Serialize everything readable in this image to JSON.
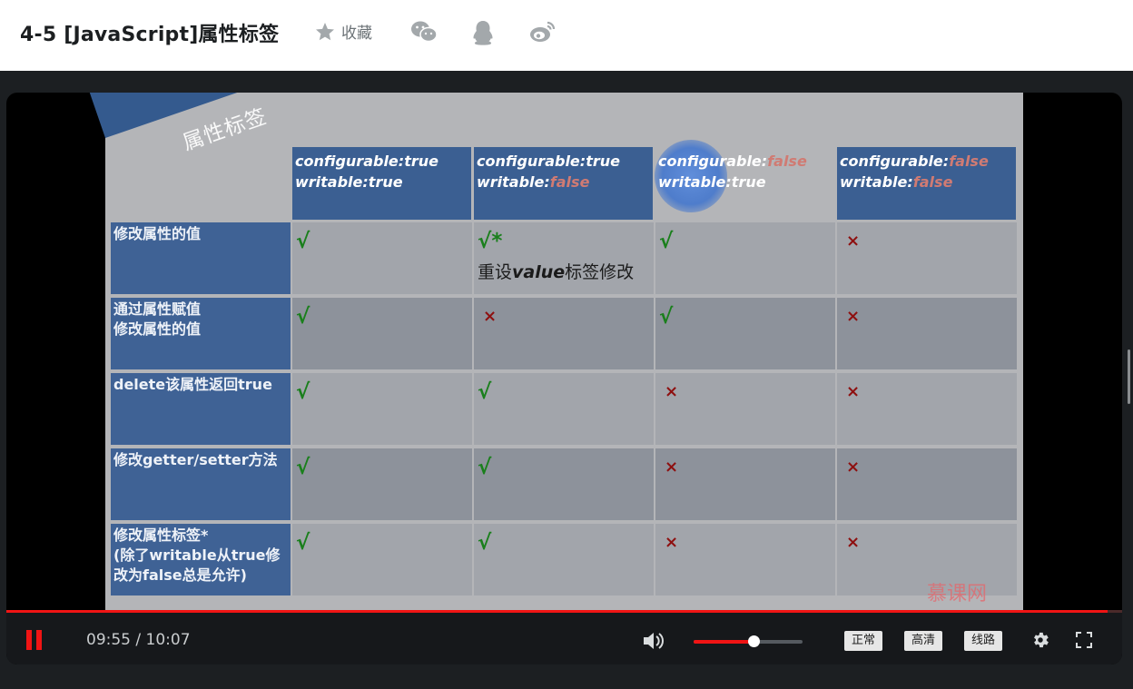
{
  "header": {
    "title": "4-5 [JavaScript]属性标签",
    "favorite_label": "收藏",
    "share_icons": [
      "wechat-icon",
      "qq-icon",
      "weibo-icon"
    ]
  },
  "slide": {
    "banner": "属性标签",
    "columns": [
      {
        "line1_key": "configurable:",
        "line1_val": "true",
        "line2_key": "writable:",
        "line2_val": "true",
        "false1": false,
        "false2": false
      },
      {
        "line1_key": "configurable:",
        "line1_val": "true",
        "line2_key": "writable:",
        "line2_val": "false",
        "false1": false,
        "false2": true
      },
      {
        "line1_key": "configurable:",
        "line1_val": "false",
        "line2_key": "writable:",
        "line2_val": "true",
        "false1": true,
        "false2": false
      },
      {
        "line1_key": "configurable:",
        "line1_val": "false",
        "line2_key": "writable:",
        "line2_val": "false",
        "false1": true,
        "false2": true
      }
    ],
    "rows": [
      {
        "label": "修改属性的值",
        "marks": [
          "√",
          "√*",
          "√",
          "×"
        ],
        "note_pre": "重设",
        "note_em": "value",
        "note_post": "标签修改"
      },
      {
        "label": "通过属性赋值\n修改属性的值",
        "marks": [
          "√",
          "×",
          "√",
          "×"
        ]
      },
      {
        "label": "delete该属性返回true",
        "marks": [
          "√",
          "√",
          "×",
          "×"
        ]
      },
      {
        "label": "修改getter/setter方法",
        "marks": [
          "√",
          "√",
          "×",
          "×"
        ]
      },
      {
        "label": "修改属性标签*\n(除了writable从true修改为false总是允许)",
        "marks": [
          "√",
          "√",
          "×",
          "×"
        ]
      }
    ],
    "watermark": "慕课网"
  },
  "player": {
    "current_time": "09:55",
    "separator": "/",
    "duration": "10:07",
    "progress_fraction": 0.987,
    "volume_fraction": 0.55,
    "quality_buttons": [
      "正常",
      "高清",
      "线路"
    ],
    "accent_color": "#f01414"
  }
}
